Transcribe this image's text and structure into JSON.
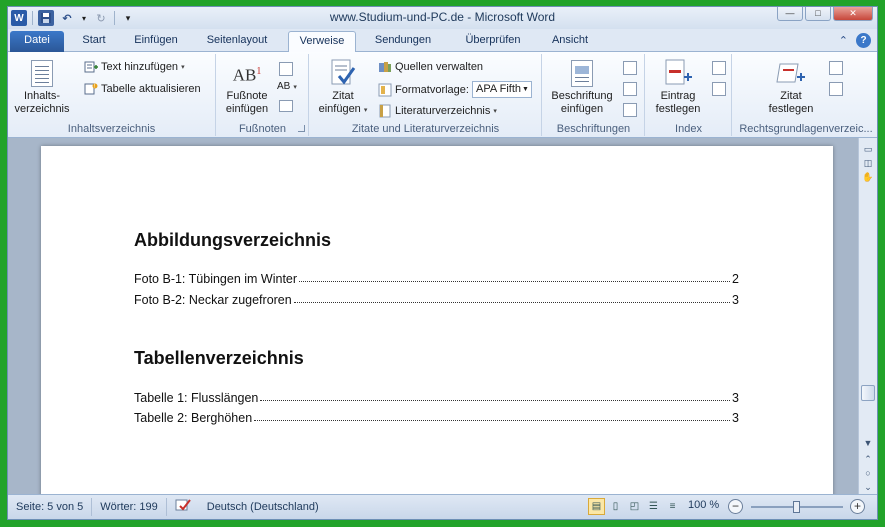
{
  "window": {
    "title": "www.Studium-und-PC.de  -  Microsoft Word",
    "qat": {
      "word": "W",
      "undo": "↶",
      "redo": "↻",
      "customize": "▾"
    },
    "controls": {
      "minimize": "—",
      "maximize": "□",
      "close": "✕"
    }
  },
  "tabs": [
    {
      "label": "Datei"
    },
    {
      "label": "Start"
    },
    {
      "label": "Einfügen"
    },
    {
      "label": "Seitenlayout"
    },
    {
      "label": "Verweise"
    },
    {
      "label": "Sendungen"
    },
    {
      "label": "Überprüfen"
    },
    {
      "label": "Ansicht"
    }
  ],
  "tab_right": {
    "collapse": "⌃",
    "help": "?"
  },
  "ribbon": {
    "inhaltsverzeichnis": {
      "label": "Inhaltsverzeichnis",
      "big_button": "Inhalts-\nverzeichnis",
      "text_hinzufuegen": "Text hinzufügen",
      "tabelle_aktualisieren": "Tabelle aktualisieren"
    },
    "fussnoten": {
      "label": "Fußnoten",
      "big_button_line1": "Fußnote",
      "big_button_line2": "einfügen",
      "icon_text": "AB",
      "icon_sup": "1",
      "small_icon_text": "AB"
    },
    "zitate": {
      "label": "Zitate und Literaturverzeichnis",
      "big_button_line1": "Zitat",
      "big_button_line2": "einfügen",
      "quellen_verwalten": "Quellen verwalten",
      "formatvorlage_label": "Formatvorlage:",
      "formatvorlage_value": "APA Fifth",
      "literaturverzeichnis": "Literaturverzeichnis"
    },
    "beschriftungen": {
      "label": "Beschriftungen",
      "big_button_line1": "Beschriftung",
      "big_button_line2": "einfügen"
    },
    "index": {
      "label": "Index",
      "big_button_line1": "Eintrag",
      "big_button_line2": "festlegen"
    },
    "rechtsgrundlagen": {
      "label": "Rechtsgrundlagenverzeic...",
      "big_button_line1": "Zitat",
      "big_button_line2": "festlegen"
    }
  },
  "document": {
    "sections": [
      {
        "heading": "Abbildungsverzeichnis",
        "entries": [
          {
            "text": "Foto B-1: Tübingen im Winter",
            "page": "2"
          },
          {
            "text": "Foto B-2: Neckar zugefroren",
            "page": "3"
          }
        ]
      },
      {
        "heading": "Tabellenverzeichnis",
        "entries": [
          {
            "text": "Tabelle 1: Flusslängen",
            "page": "3"
          },
          {
            "text": "Tabelle 2: Berghöhen",
            "page": "3"
          }
        ]
      }
    ]
  },
  "statusbar": {
    "page": "Seite: 5 von 5",
    "words": "Wörter: 199",
    "language": "Deutsch (Deutschland)",
    "zoom": "100 %",
    "zoom_out": "−",
    "zoom_in": "+"
  },
  "colors": {
    "frame": "#22a32a",
    "file_tab": "#2b5797",
    "ribbon_bg": "#e4ecf7"
  }
}
